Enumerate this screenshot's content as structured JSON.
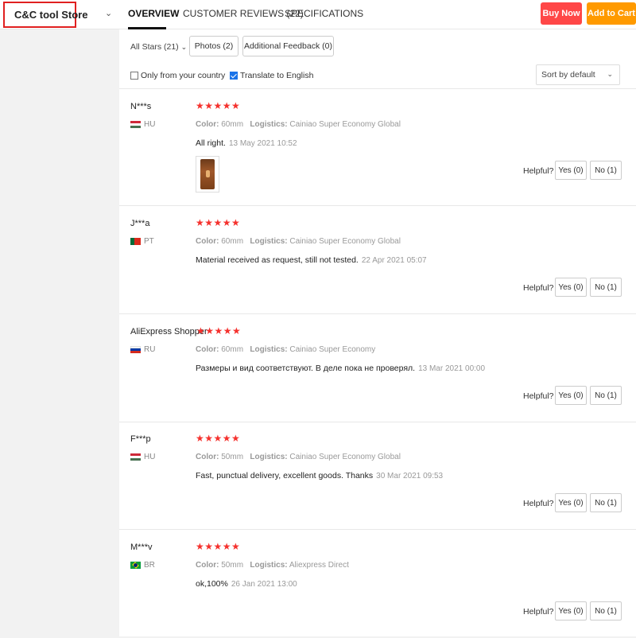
{
  "header": {
    "store_name": "C&C tool Store",
    "tabs": [
      "OVERVIEW",
      "CUSTOMER REVIEWS (22)",
      "SPECIFICATIONS"
    ],
    "buy_now": "Buy Now",
    "add_to_cart": "Add to Cart"
  },
  "filters": {
    "all_stars": "All Stars (21)",
    "photos": "Photos (2)",
    "additional_feedback": "Additional Feedback (0)",
    "only_your_country": "Only from your country",
    "translate": "Translate to English",
    "sort": "Sort by default"
  },
  "labels": {
    "color": "Color:",
    "logistics": "Logistics:",
    "helpful": "Helpful?"
  },
  "reviews": [
    {
      "name": "N***s",
      "country": "HU",
      "stars": "★★★★★",
      "color": "60mm",
      "logistics": "Cainiao Super Economy Global",
      "text": "All right.",
      "date": "13 May 2021 10:52",
      "yes": "Yes (0)",
      "no": "No (1)"
    },
    {
      "name": "J***a",
      "country": "PT",
      "stars": "★★★★★",
      "color": "60mm",
      "logistics": "Cainiao Super Economy Global",
      "text": "Material received as request, still not tested.",
      "date": "22 Apr 2021 05:07",
      "yes": "Yes (0)",
      "no": "No (1)"
    },
    {
      "name": "AliExpress Shopper",
      "country": "RU",
      "stars": "★★★★★",
      "color": "60mm",
      "logistics": "Cainiao Super Economy",
      "text": "Размеры и вид соответствуют. В деле пока не проверял.",
      "date": "13 Mar 2021 00:00",
      "yes": "Yes (0)",
      "no": "No (1)"
    },
    {
      "name": "F***p",
      "country": "HU",
      "stars": "★★★★★",
      "color": "50mm",
      "logistics": "Cainiao Super Economy Global",
      "text": "Fast, punctual delivery, excellent goods. Thanks",
      "date": "30 Mar 2021 09:53",
      "yes": "Yes (0)",
      "no": "No (1)"
    },
    {
      "name": "M***v",
      "country": "BR",
      "stars": "★★★★★",
      "color": "50mm",
      "logistics": "Aliexpress Direct",
      "text": "ok,100%",
      "date": "26 Jan 2021 13:00",
      "yes": "Yes (0)",
      "no": "No (1)"
    }
  ]
}
